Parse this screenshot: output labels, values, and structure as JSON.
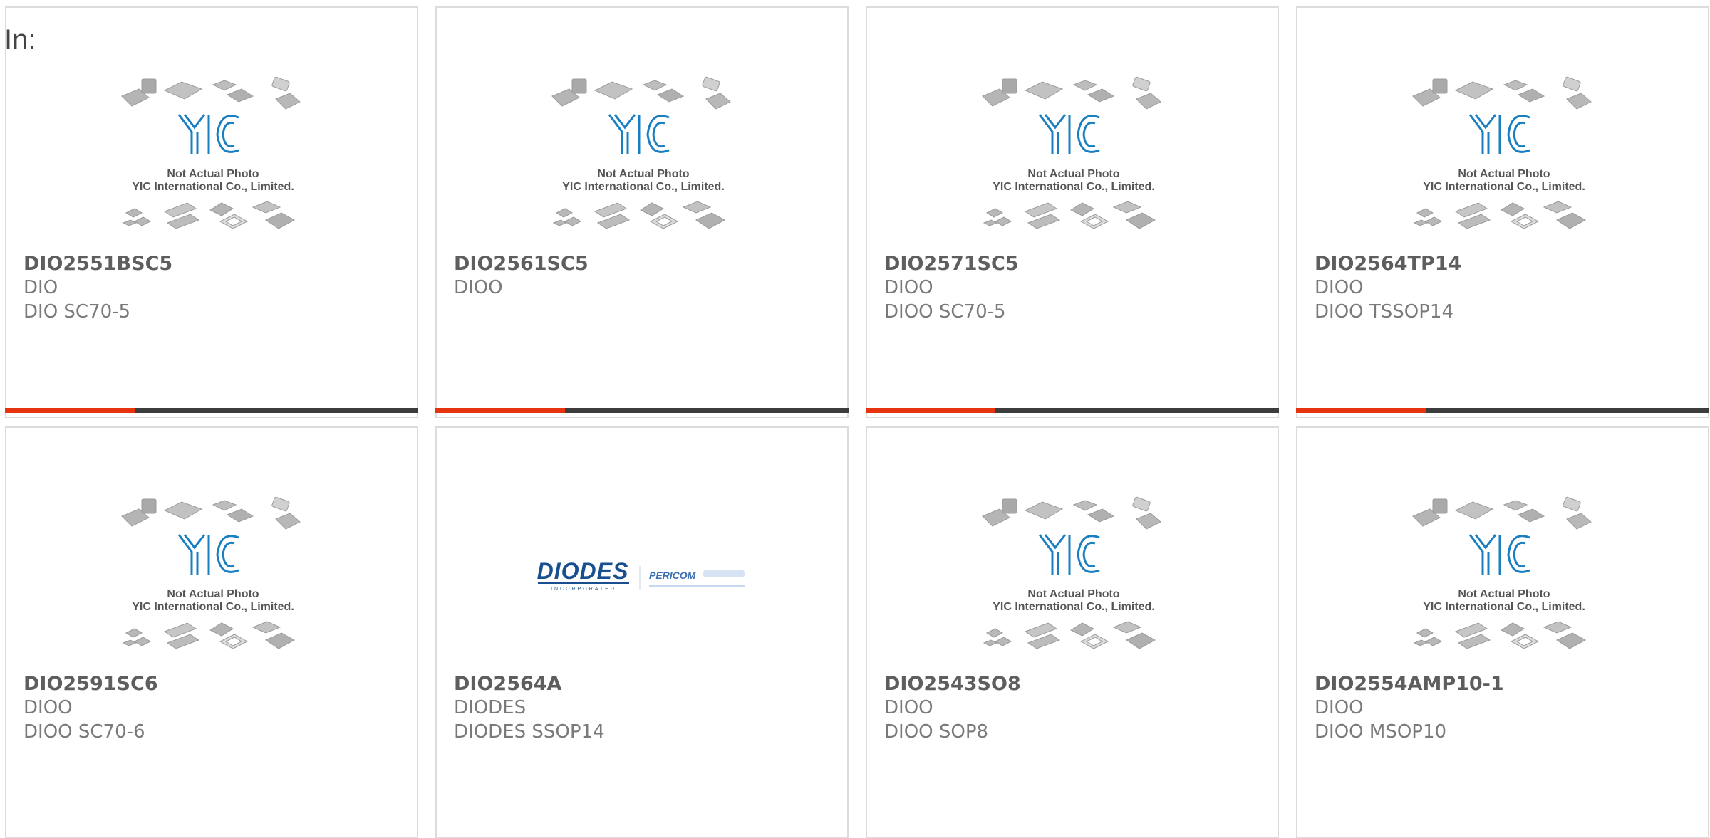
{
  "page": {
    "in_label": "In:"
  },
  "placeholder": {
    "line1": "Not Actual Photo",
    "line2": "YIC International Co., Limited.",
    "logo_text": "YIC",
    "brand_color": "#1a7fc1"
  },
  "diodes_logo": {
    "brand": "DIODES",
    "tagline": "INCORPORATED",
    "partner": "PERICOM",
    "brand_color": "#1a4f8f"
  },
  "colors": {
    "accent": "#e6340e",
    "bar": "#3c3c3c",
    "border": "#dcdcdc"
  },
  "products": [
    {
      "part": "DIO2551BSC5",
      "manufacturer": "DIO",
      "package": "DIO SC70-5",
      "image": "yic-placeholder"
    },
    {
      "part": "DIO2561SC5",
      "manufacturer": "DIOO",
      "package": "",
      "image": "yic-placeholder"
    },
    {
      "part": "DIO2571SC5",
      "manufacturer": "DIOO",
      "package": "DIOO SC70-5",
      "image": "yic-placeholder"
    },
    {
      "part": "DIO2564TP14",
      "manufacturer": "DIOO",
      "package": "DIOO TSSOP14",
      "image": "yic-placeholder"
    },
    {
      "part": "DIO2591SC6",
      "manufacturer": "DIOO",
      "package": "DIOO SC70-6",
      "image": "yic-placeholder"
    },
    {
      "part": "DIO2564A",
      "manufacturer": "DIODES",
      "package": "DIODES SSOP14",
      "image": "diodes-logo"
    },
    {
      "part": "DIO2543SO8",
      "manufacturer": "DIOO",
      "package": "DIOO SOP8",
      "image": "yic-placeholder"
    },
    {
      "part": "DIO2554AMP10-1",
      "manufacturer": "DIOO",
      "package": "DIOO MSOP10",
      "image": "yic-placeholder"
    }
  ]
}
